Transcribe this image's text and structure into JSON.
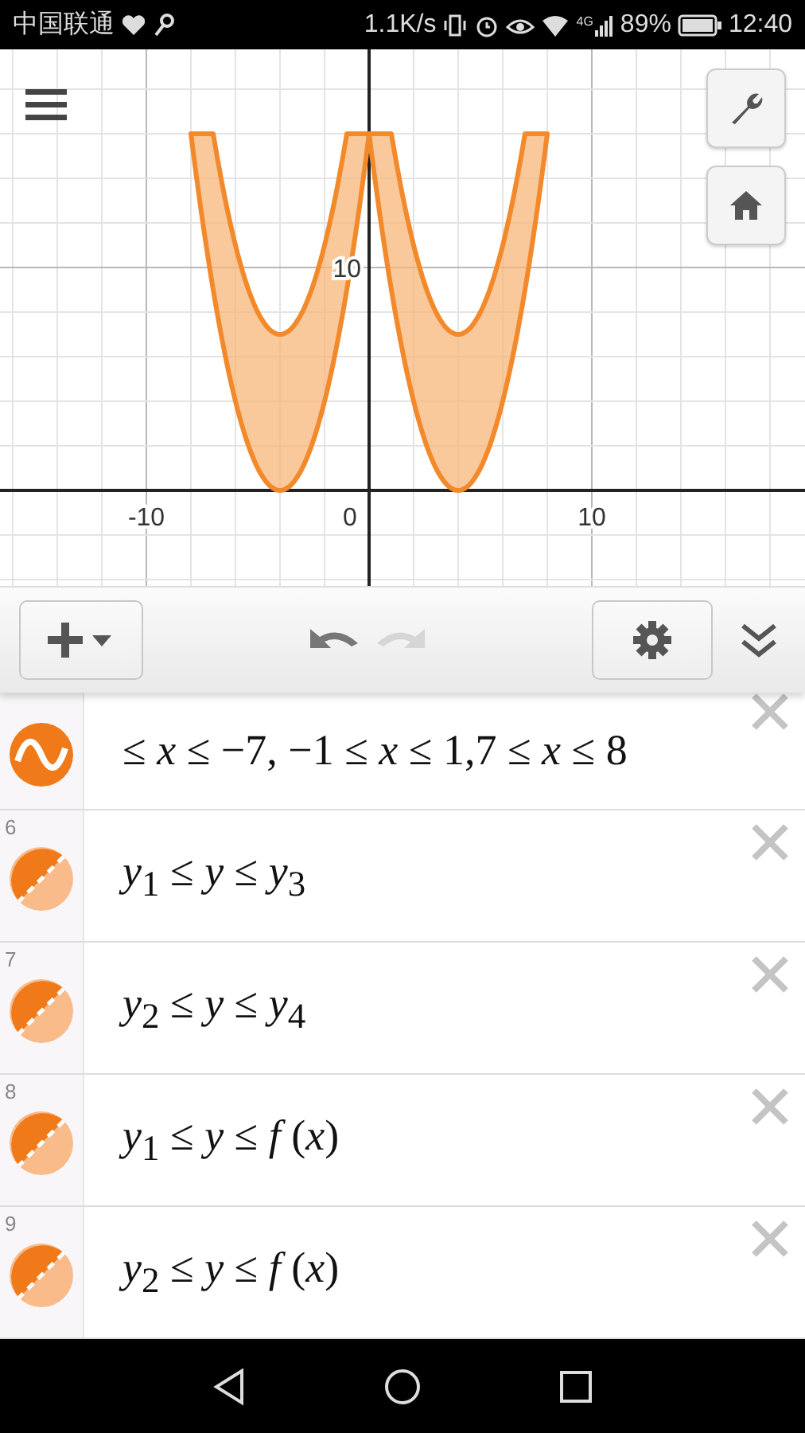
{
  "status_bar": {
    "carrier": "中国联通",
    "speed": "1.1K/s",
    "network": "4G",
    "battery": "89%",
    "time": "12:40"
  },
  "graph": {
    "x_labels": [
      {
        "text": "-10"
      },
      {
        "text": "0"
      },
      {
        "text": "10"
      }
    ],
    "y_labels": [
      {
        "text": "10"
      }
    ]
  },
  "toolbar": {
    "undo": {
      "disabled": false
    },
    "redo": {
      "disabled": true
    }
  },
  "expressions": [
    {
      "kind": "graph",
      "latex": "≤ *x* ≤ −7, −1 ≤ *x* ≤ 1,7 ≤ *x* ≤ 8"
    },
    {
      "kind": "region",
      "number": "6",
      "latex": "*y*$_{1}$ ≤ *y* ≤ *y*$_{3}$"
    },
    {
      "kind": "region",
      "number": "7",
      "latex": "*y*$_{2}$ ≤ *y* ≤ *y*$_{4}$"
    },
    {
      "kind": "region",
      "number": "8",
      "latex": "*y*$_{1}$ ≤ *y* ≤ *f* (*x*)"
    },
    {
      "kind": "region",
      "number": "9",
      "latex": "*y*$_{2}$ ≤ *y* ≤ *f* (*x*)"
    }
  ]
}
